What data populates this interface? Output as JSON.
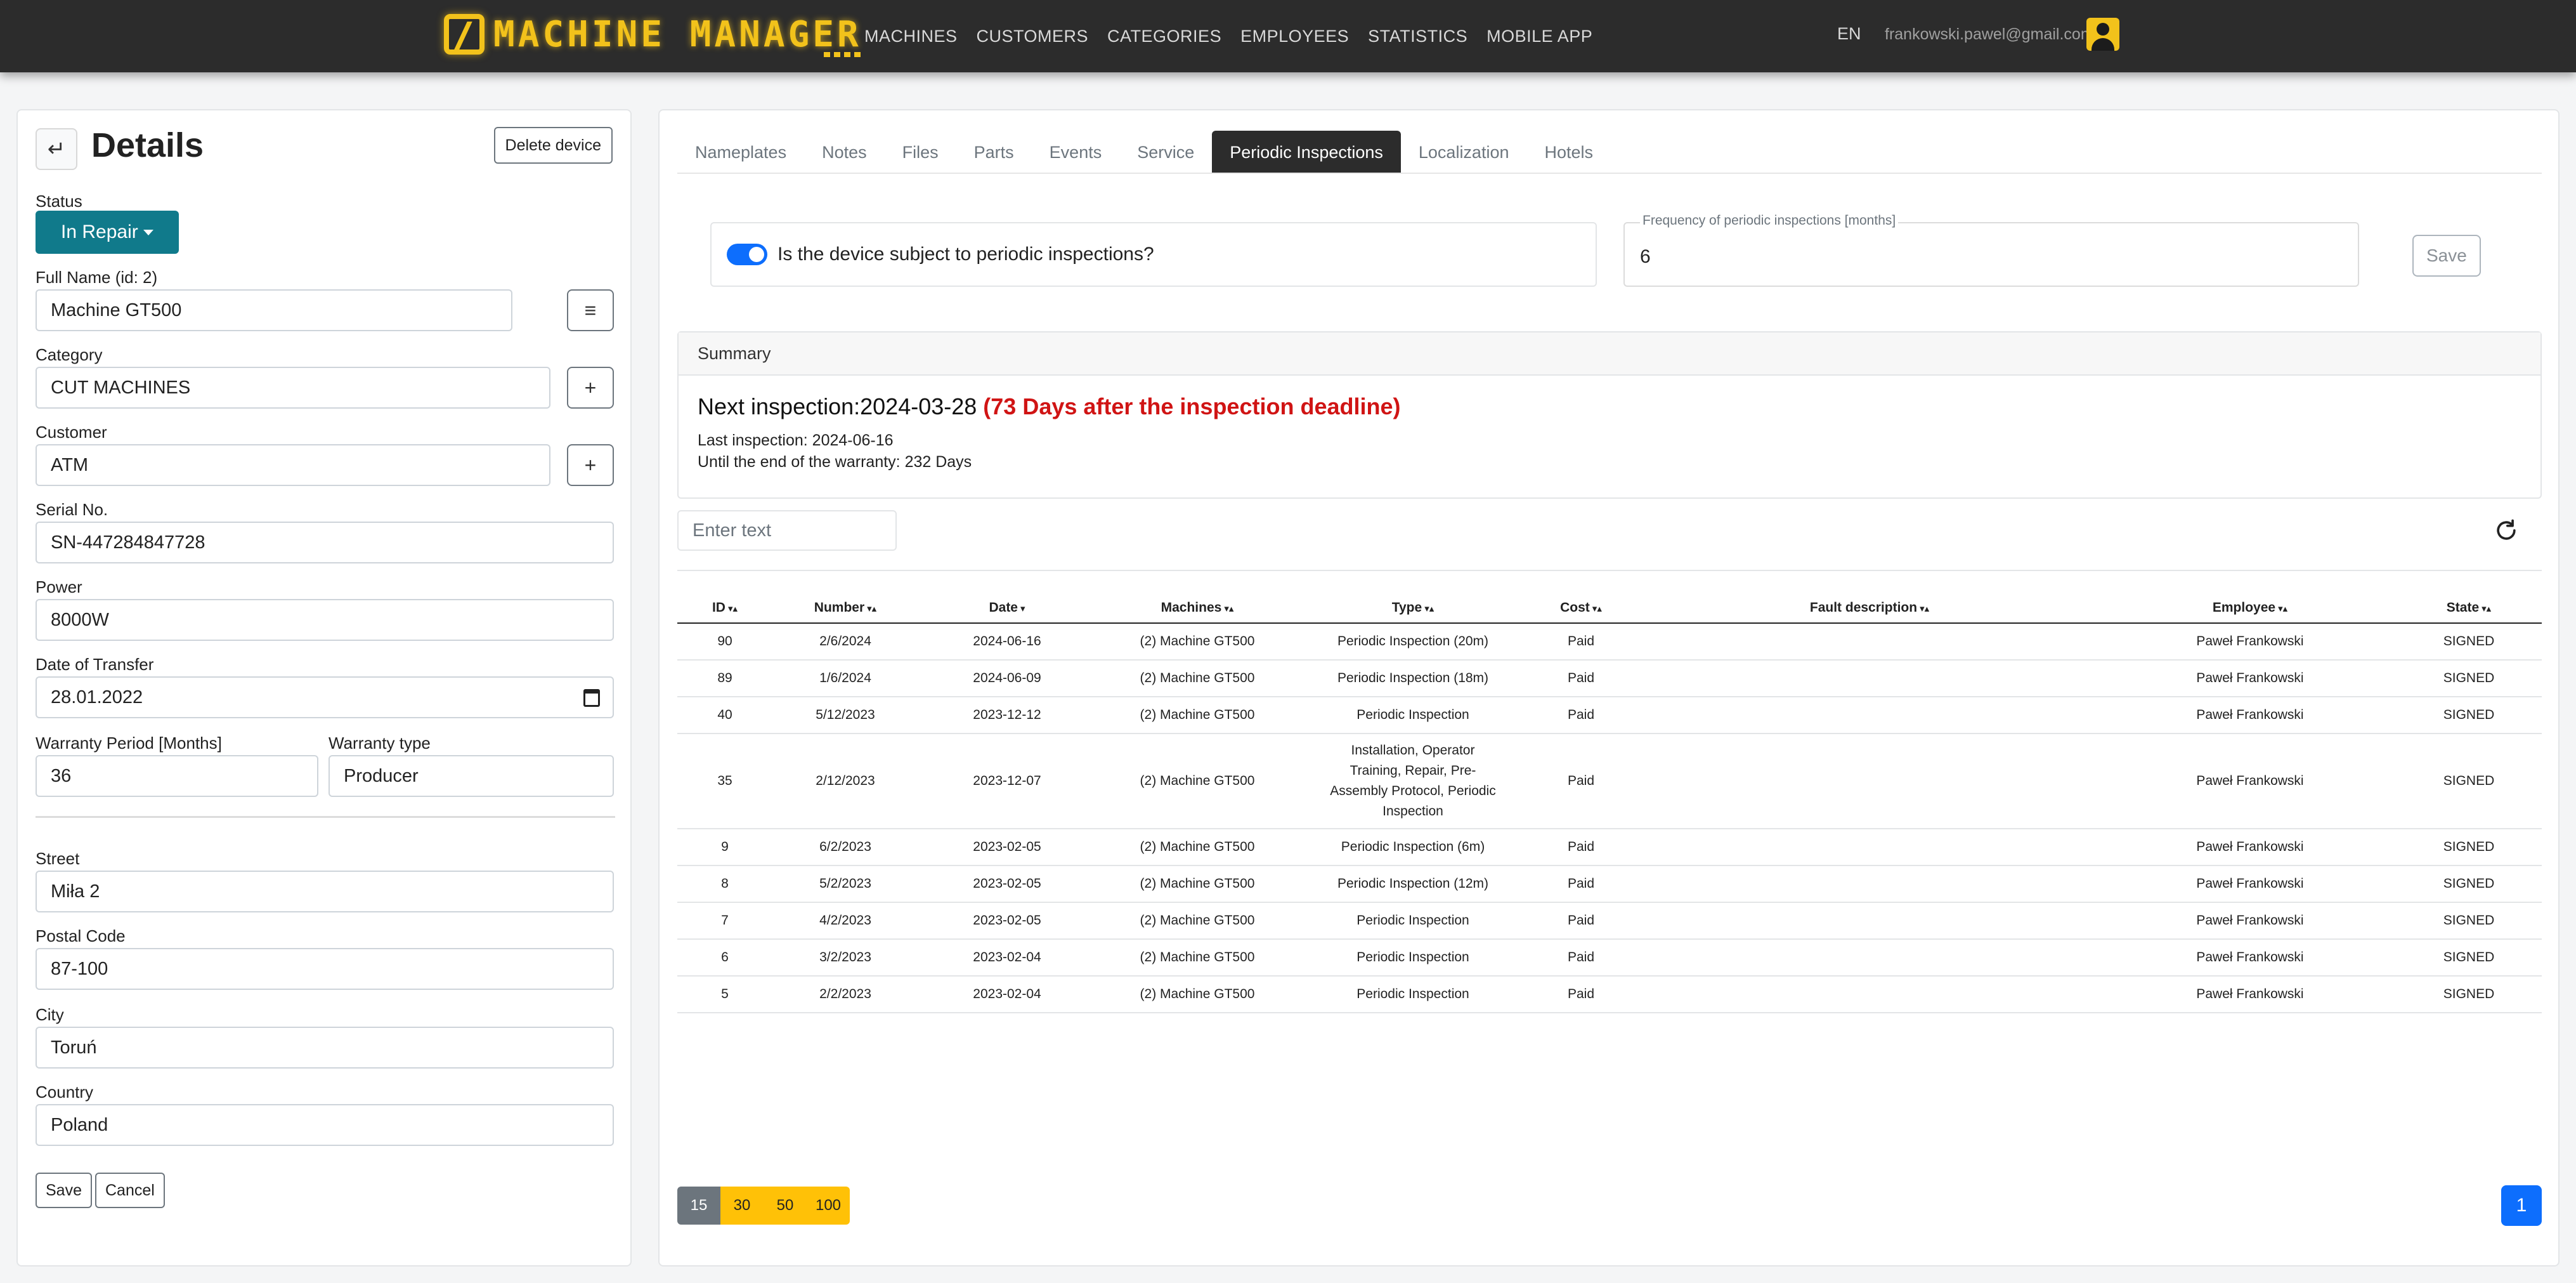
{
  "navbar": {
    "brand": "MACHINE MANAGER",
    "links": [
      "MACHINES",
      "CUSTOMERS",
      "CATEGORIES",
      "EMPLOYEES",
      "STATISTICS",
      "MOBILE APP"
    ],
    "lang": "EN",
    "email": "frankowski.pawel@gmail.com"
  },
  "details": {
    "title": "Details",
    "delete_label": "Delete device",
    "status_label": "Status",
    "status_value": "In Repair",
    "full_name_label": "Full Name (id: 2)",
    "full_name": "Machine GT500",
    "category_label": "Category",
    "category": "CUT MACHINES",
    "customer_label": "Customer",
    "customer": "ATM",
    "serial_label": "Serial No.",
    "serial": "SN-447284847728",
    "power_label": "Power",
    "power": "8000W",
    "transfer_label": "Date of Transfer",
    "transfer": "28.01.2022",
    "warranty_period_label": "Warranty Period [Months]",
    "warranty_period": "36",
    "warranty_type_label": "Warranty type",
    "warranty_type": "Producer",
    "street_label": "Street",
    "street": "Miła 2",
    "postal_label": "Postal Code",
    "postal": "87-100",
    "city_label": "City",
    "city": "Toruń",
    "country_label": "Country",
    "country": "Poland",
    "save_label": "Save",
    "cancel_label": "Cancel",
    "list_icon": "≡",
    "plus_icon": "+",
    "back_icon": "↵"
  },
  "tabs": [
    "Nameplates",
    "Notes",
    "Files",
    "Parts",
    "Events",
    "Service",
    "Periodic Inspections",
    "Localization",
    "Hotels"
  ],
  "active_tab": "Periodic Inspections",
  "inspections": {
    "toggle_label": "Is the device subject to periodic inspections?",
    "freq_label": "Frequency of periodic inspections [months]",
    "freq_value": "6",
    "save_label": "Save",
    "summary_title": "Summary",
    "next_prefix": "Next inspection:2024-03-28",
    "next_overdue": "(73 Days after the inspection deadline)",
    "last_inspection": "Last inspection: 2024-06-16",
    "warranty_end": "Until the end of the warranty: 232 Days",
    "search_placeholder": "Enter text"
  },
  "table": {
    "columns": [
      "ID",
      "Number",
      "Date",
      "Machines",
      "Type",
      "Cost",
      "Fault description",
      "Employee",
      "State"
    ],
    "rows": [
      [
        "90",
        "2/6/2024",
        "2024-06-16",
        "(2) Machine GT500",
        "Periodic Inspection (20m)",
        "Paid",
        "",
        "Paweł Frankowski",
        "SIGNED"
      ],
      [
        "89",
        "1/6/2024",
        "2024-06-09",
        "(2) Machine GT500",
        "Periodic Inspection (18m)",
        "Paid",
        "",
        "Paweł Frankowski",
        "SIGNED"
      ],
      [
        "40",
        "5/12/2023",
        "2023-12-12",
        "(2) Machine GT500",
        "Periodic Inspection",
        "Paid",
        "",
        "Paweł Frankowski",
        "SIGNED"
      ],
      [
        "35",
        "2/12/2023",
        "2023-12-07",
        "(2) Machine GT500",
        "Installation, Operator Training, Repair, Pre-Assembly Protocol, Periodic Inspection",
        "Paid",
        "",
        "Paweł Frankowski",
        "SIGNED"
      ],
      [
        "9",
        "6/2/2023",
        "2023-02-05",
        "(2) Machine GT500",
        "Periodic Inspection (6m)",
        "Paid",
        "",
        "Paweł Frankowski",
        "SIGNED"
      ],
      [
        "8",
        "5/2/2023",
        "2023-02-05",
        "(2) Machine GT500",
        "Periodic Inspection (12m)",
        "Paid",
        "",
        "Paweł Frankowski",
        "SIGNED"
      ],
      [
        "7",
        "4/2/2023",
        "2023-02-05",
        "(2) Machine GT500",
        "Periodic Inspection",
        "Paid",
        "",
        "Paweł Frankowski",
        "SIGNED"
      ],
      [
        "6",
        "3/2/2023",
        "2023-02-04",
        "(2) Machine GT500",
        "Periodic Inspection",
        "Paid",
        "",
        "Paweł Frankowski",
        "SIGNED"
      ],
      [
        "5",
        "2/2/2023",
        "2023-02-04",
        "(2) Machine GT500",
        "Periodic Inspection",
        "Paid",
        "",
        "Paweł Frankowski",
        "SIGNED"
      ]
    ],
    "sort_arrows": "▾▴",
    "page_sizes": [
      "15",
      "30",
      "50",
      "100"
    ],
    "page": "1"
  },
  "colors": {
    "accent": "#f2c21b",
    "status": "#107a8b",
    "overdue": "#d01414",
    "primary": "#0d6efd"
  }
}
